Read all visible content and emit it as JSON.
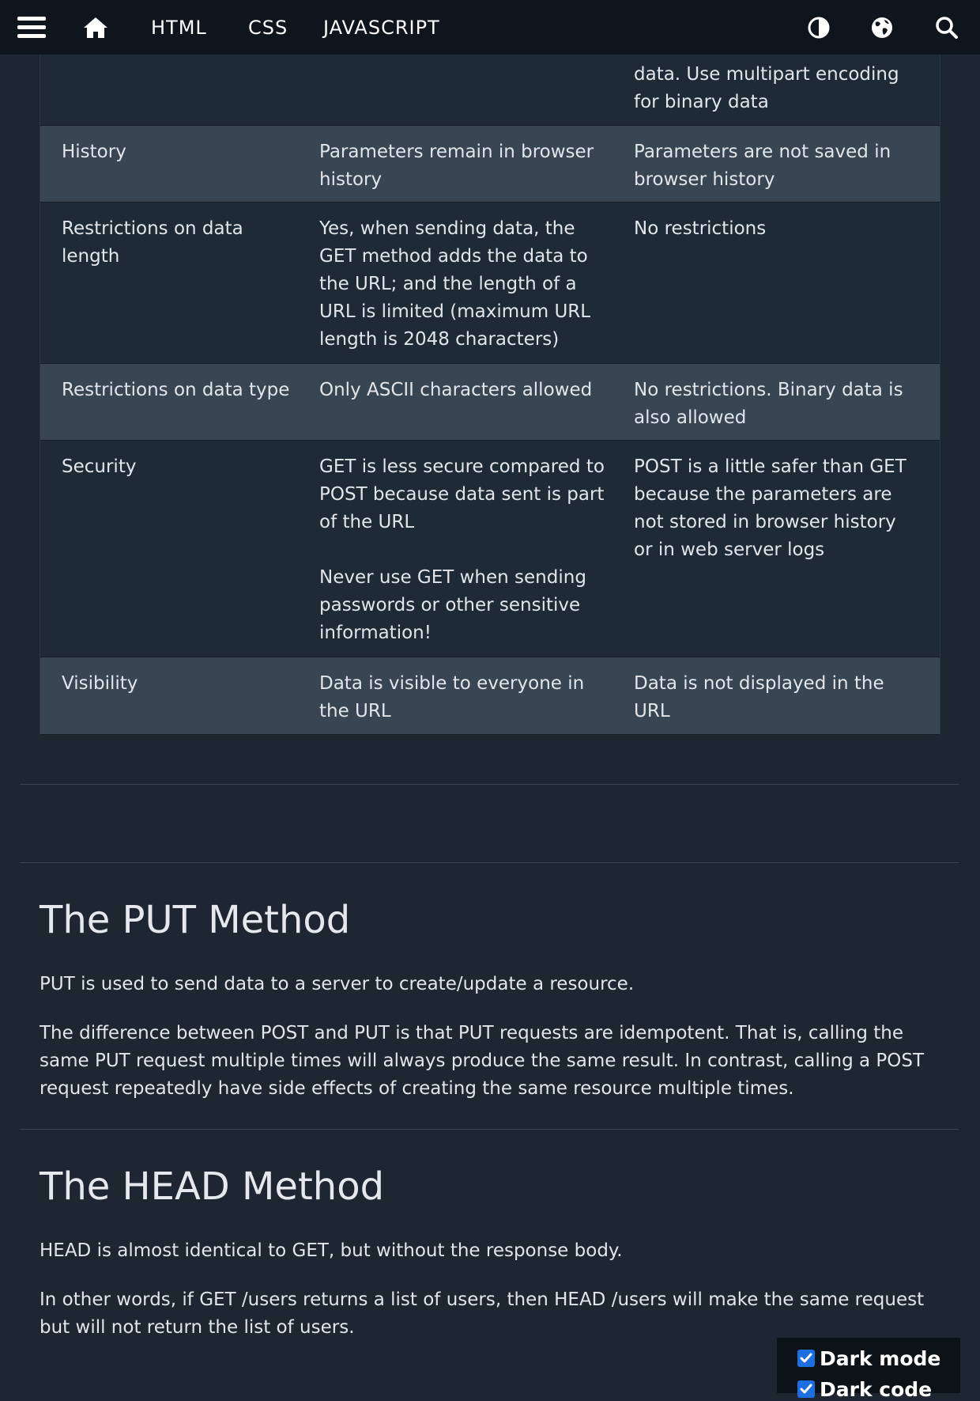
{
  "nav": {
    "menu_icon": "hamburger-menu-icon",
    "home_icon": "home-icon",
    "links": [
      "HTML",
      "CSS",
      "JAVASCRIPT"
    ],
    "contrast_icon": "contrast-icon",
    "globe_icon": "globe-icon",
    "search_icon": "search-icon"
  },
  "table": {
    "partial_top": {
      "col2": "",
      "col3": "data. Use multipart encoding\nfor binary data"
    },
    "rows": [
      {
        "label": "History",
        "get": "Parameters remain in browser\nhistory",
        "post": "Parameters are not saved in\nbrowser history"
      },
      {
        "label": "Restrictions on data\nlength",
        "get": "Yes, when sending data, the\nGET method adds the data to\nthe URL; and the length of a\nURL is limited (maximum URL\nlength is 2048 characters)",
        "post": "No restrictions"
      },
      {
        "label": "Restrictions on data type",
        "get": "Only ASCII characters allowed",
        "post": "No restrictions. Binary data is\nalso allowed"
      },
      {
        "label": "Security",
        "get": "GET is less secure compared to\nPOST because data sent is part\nof the URL\n\nNever use GET when sending\npasswords or other sensitive\ninformation!",
        "post": "POST is a little safer than GET\nbecause the parameters are\nnot stored in browser history\nor in web server logs"
      },
      {
        "label": "Visibility",
        "get": "Data is visible to everyone in\nthe URL",
        "post": "Data is not displayed in the\nURL"
      }
    ]
  },
  "put_section": {
    "heading": "The PUT Method",
    "p1": "PUT is used to send data to a server to create/update a resource.",
    "p2": "The difference between POST and PUT is that PUT requests are idempotent. That is, calling the same PUT request multiple times will always produce the same result. In contrast, calling a POST request repeatedly have side effects of creating the same resource multiple times."
  },
  "head_section": {
    "heading": "The HEAD Method",
    "p1": "HEAD is almost identical to GET, but without the response body.",
    "p2": "In other words, if GET /users returns a list of users, then HEAD /users will make the same request but will not return the list of users."
  },
  "dark_mode": {
    "label": "Dark mode",
    "checked": true,
    "second_label": "Dark code",
    "second_checked": true,
    "accent": "#1c6fe0"
  },
  "colors": {
    "page_bg": "#1d2631",
    "nav_bg": "#0e151d",
    "row_dark": "#1e2a36",
    "row_light": "#384552"
  }
}
